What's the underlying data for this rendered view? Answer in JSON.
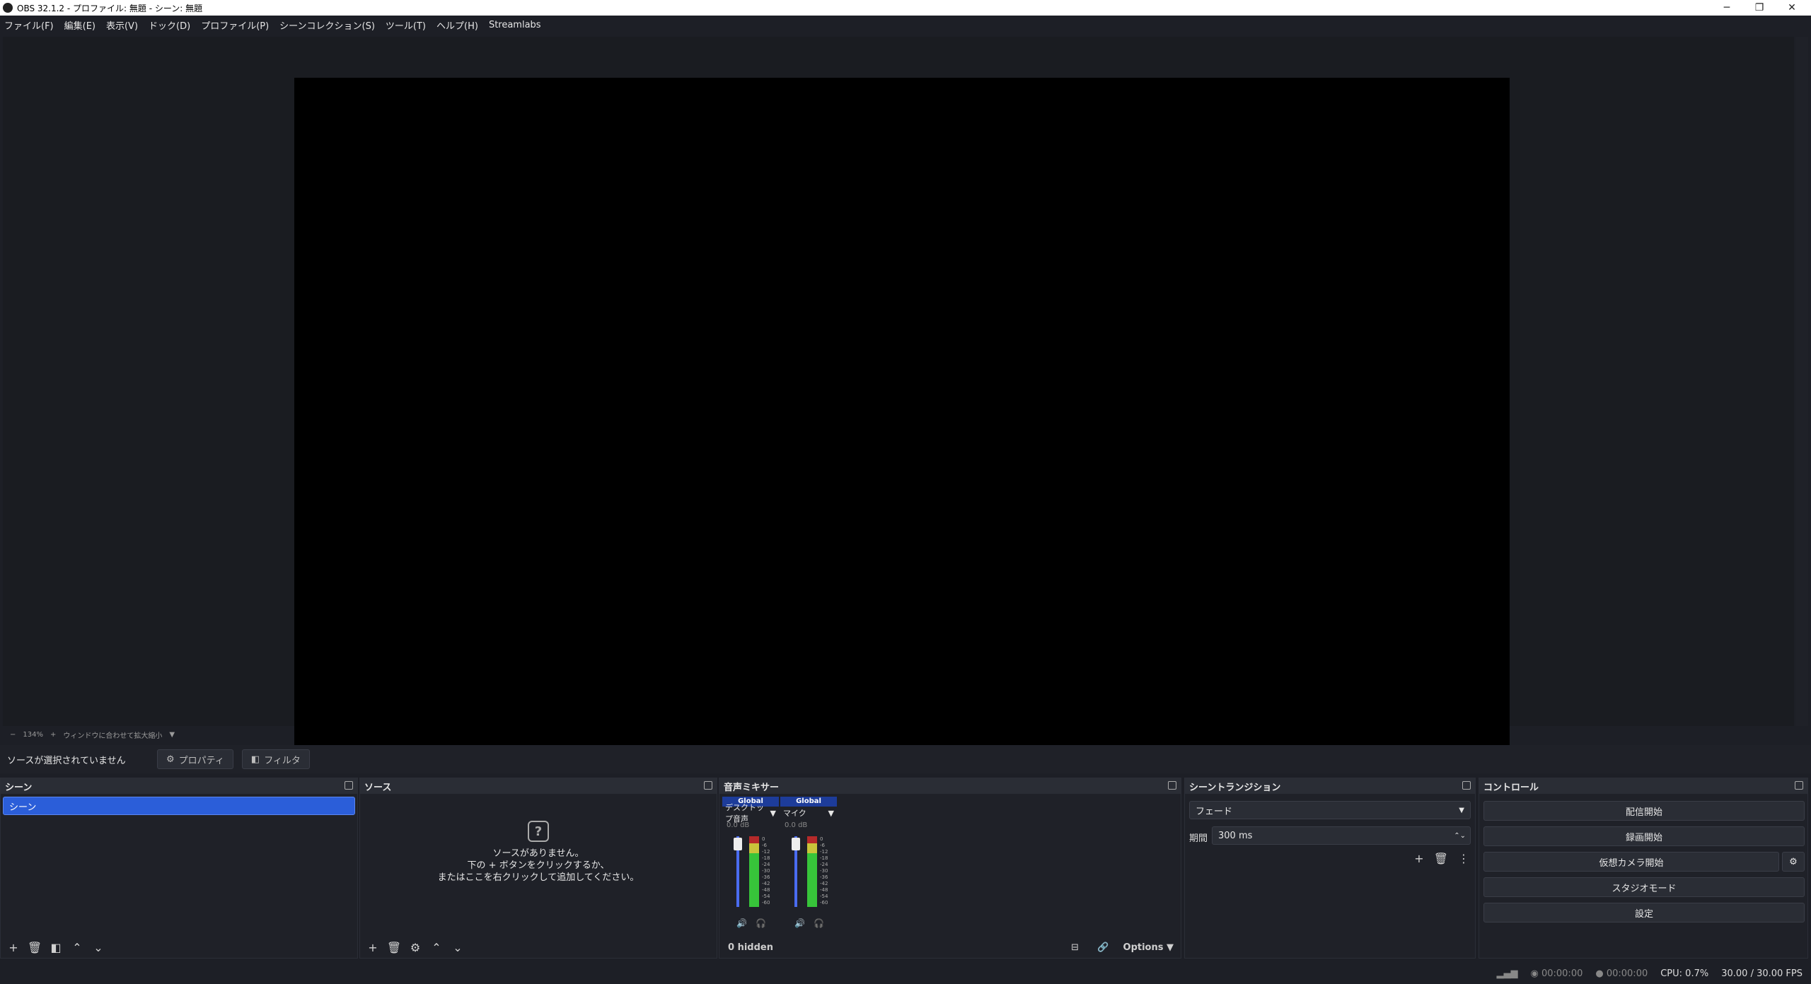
{
  "window": {
    "title": "OBS 32.1.2 - プロファイル: 無題 - シーン: 無題",
    "controls": {
      "min": "─",
      "max": "❐",
      "close": "✕"
    }
  },
  "menu": [
    "ファイル(F)",
    "編集(E)",
    "表示(V)",
    "ドック(D)",
    "プロファイル(P)",
    "シーンコレクション(S)",
    "ツール(T)",
    "ヘルプ(H)",
    "Streamlabs"
  ],
  "zoom": {
    "minus": "−",
    "percent": "134%",
    "plus": "+",
    "fit_label": "ウィンドウに合わせて拡大縮小",
    "dropdown": "▼"
  },
  "source_bar": {
    "no_source": "ソースが選択されていません",
    "properties": "プロパティ",
    "filters": "フィルタ"
  },
  "scenes": {
    "title": "シーン",
    "items": [
      "シーン"
    ]
  },
  "sources": {
    "title": "ソース",
    "empty_line1": "ソースがありません。",
    "empty_line2": "下の + ボタンをクリックするか、",
    "empty_line3": "またはここを右クリックして追加してください。"
  },
  "mixer": {
    "title": "音声ミキサー",
    "channels": [
      {
        "badge": "Global",
        "name": "デスクトップ音声",
        "db": "0.0 dB"
      },
      {
        "badge": "Global",
        "name": "マイク",
        "db": "0.0 dB"
      }
    ],
    "ticks": [
      "0",
      "-6",
      "-12",
      "-18",
      "-24",
      "-30",
      "-36",
      "-42",
      "-48",
      "-54",
      "-60"
    ],
    "hidden": "0 hidden",
    "options": "Options"
  },
  "transitions": {
    "title": "シーントランジション",
    "selected": "フェード",
    "duration_label": "期間",
    "duration": "300 ms"
  },
  "controls": {
    "title": "コントロール",
    "start_stream": "配信開始",
    "start_record": "録画開始",
    "virtual_cam": "仮想カメラ開始",
    "studio_mode": "スタジオモード",
    "settings": "設定"
  },
  "status": {
    "stream_time": "00:00:00",
    "record_time": "00:00:00",
    "cpu": "CPU: 0.7%",
    "fps": "30.00 / 30.00 FPS"
  }
}
